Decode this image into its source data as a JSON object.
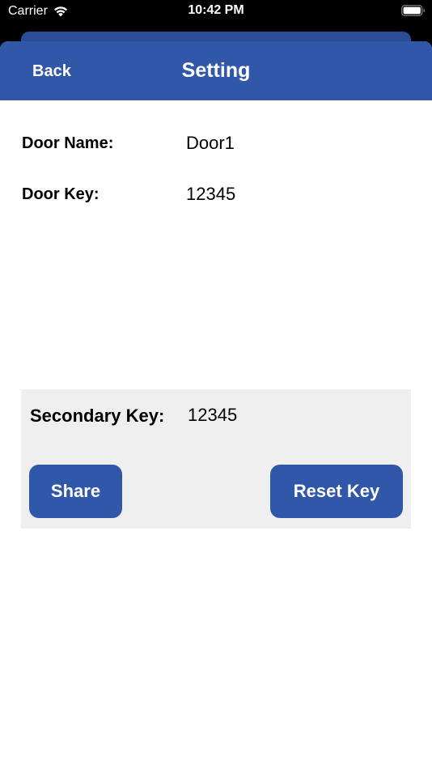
{
  "status_bar": {
    "carrier": "Carrier",
    "time": "10:42 PM",
    "icons": [
      "wifi-icon",
      "battery-icon"
    ]
  },
  "nav": {
    "back_label": "Back",
    "title": "Setting"
  },
  "fields": {
    "door_name": {
      "label": "Door Name:",
      "value": "Door1"
    },
    "door_key": {
      "label": "Door Key:",
      "value": "12345"
    }
  },
  "secondary": {
    "label": "Secondary Key:",
    "value": "12345",
    "share_label": "Share",
    "reset_label": "Reset Key"
  },
  "colors": {
    "accent": "#3157a8",
    "panel": "#efefef",
    "background": "#ffffff"
  }
}
